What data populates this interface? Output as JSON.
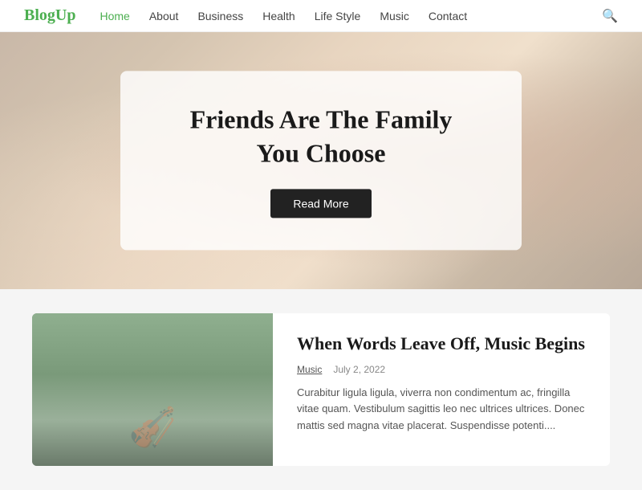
{
  "header": {
    "logo_text": "Blog",
    "logo_accent": "Up",
    "nav": [
      {
        "label": "Home",
        "active": true
      },
      {
        "label": "About",
        "active": false
      },
      {
        "label": "Business",
        "active": false
      },
      {
        "label": "Health",
        "active": false
      },
      {
        "label": "Life Style",
        "active": false
      },
      {
        "label": "Music",
        "active": false
      },
      {
        "label": "Contact",
        "active": false
      }
    ]
  },
  "hero": {
    "title": "Friends Are The Family You Choose",
    "button_label": "Read More"
  },
  "blog": {
    "post": {
      "title": "When Words Leave Off, Music Begins",
      "category": "Music",
      "date": "July 2, 2022",
      "excerpt": "Curabitur ligula ligula, viverra non condimentum ac, fringilla vitae quam. Vestibulum sagittis leo nec ultrices ultrices. Donec mattis sed magna vitae placerat. Suspendisse potenti...."
    }
  }
}
